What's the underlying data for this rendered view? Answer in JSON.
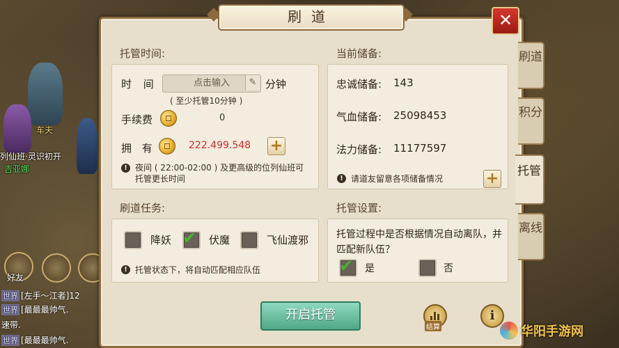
{
  "window": {
    "title": "刷道",
    "close_label": "✕"
  },
  "side_tabs": [
    {
      "label": "刷道",
      "active": false
    },
    {
      "label": "积分",
      "active": false
    },
    {
      "label": "托管",
      "active": true
    },
    {
      "label": "离线",
      "active": false
    }
  ],
  "hosting_time": {
    "section_title": "托管时间:",
    "time_label": "时 间",
    "input_placeholder": "点击输入",
    "unit": "分钟",
    "min_note": "( 至少托管10分钟 )",
    "fee_label": "手续费",
    "fee_value": "0",
    "own_label": "拥 有",
    "own_value": "222.499.548",
    "note": "夜间 ( 22:00-02:00 ) 及更高级的位列仙班可托管更长时间"
  },
  "reserves": {
    "section_title": "当前储备:",
    "loyalty_label": "忠诚储备:",
    "loyalty_value": "143",
    "hp_label": "气血储备:",
    "hp_value": "25098453",
    "mana_label": "法力储备:",
    "mana_value": "11177597",
    "note": "请道友留意各项储备情况"
  },
  "tasks": {
    "section_title": "刷道任务:",
    "items": [
      {
        "label": "降妖",
        "checked": false
      },
      {
        "label": "伏魔",
        "checked": true
      },
      {
        "label": "飞仙渡邪",
        "checked": false
      }
    ],
    "note": "托管状态下，将自动匹配相应队伍"
  },
  "settings": {
    "section_title": "托管设置:",
    "question": "托管过程中是否根据情况自动离队，并匹配新队伍？",
    "yes_label": "是",
    "yes_checked": true,
    "no_label": "否",
    "no_checked": false
  },
  "footer": {
    "start_label": "开启托管",
    "stats_label": "结算",
    "info_label": "i"
  },
  "background": {
    "npc_name": "车夫",
    "player_title": "列仙班·灵识初开",
    "player_name": "吉亚娜",
    "friend_label": "好友",
    "chat": [
      {
        "tag": "世界",
        "text": "[左手～江者]12"
      },
      {
        "tag": "世界",
        "text": "[最最最帅气."
      },
      {
        "tag": "",
        "text": "速带."
      },
      {
        "tag": "世界",
        "text": "[最最最帅气."
      }
    ]
  },
  "watermark": "华阳手游网",
  "colors": {
    "accent_red": "#c0281f",
    "money_red": "#d42a2a",
    "start_green": "#5fb898",
    "frame_brown": "#8c6a3e"
  }
}
